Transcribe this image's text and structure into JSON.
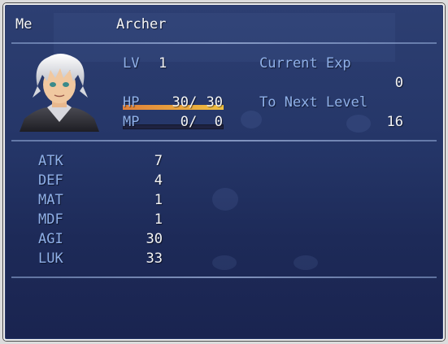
{
  "actor": {
    "name": "Me",
    "class": "Archer"
  },
  "status": {
    "lv_label": "LV",
    "lv_value": "1",
    "hp_label": "HP",
    "hp_current": "30",
    "hp_separator": "/",
    "hp_max": "30",
    "hp_ratio": 1.0,
    "mp_label": "MP",
    "mp_current": "0",
    "mp_separator": "/",
    "mp_max": "0",
    "mp_ratio": 0.0
  },
  "exp": {
    "current_label": "Current Exp",
    "current_value": "0",
    "next_label": "To Next Level",
    "next_value": "16"
  },
  "params": [
    {
      "label": "ATK",
      "value": "7"
    },
    {
      "label": "DEF",
      "value": "4"
    },
    {
      "label": "MAT",
      "value": "1"
    },
    {
      "label": "MDF",
      "value": "1"
    },
    {
      "label": "AGI",
      "value": "30"
    },
    {
      "label": "LUK",
      "value": "33"
    }
  ],
  "colors": {
    "system_text": "#8fb0e8",
    "normal_text": "#f4f4f4",
    "hp_gauge": "#f0c040",
    "mp_gauge": "#60a0f0",
    "window_bg": "#243567"
  }
}
